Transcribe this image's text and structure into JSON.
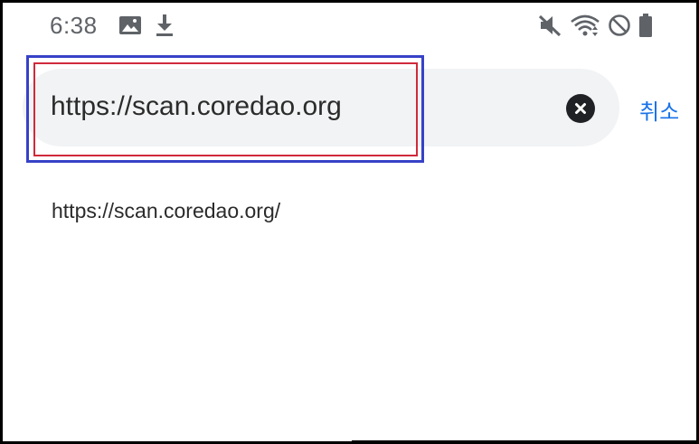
{
  "status_bar": {
    "time": "6:38",
    "left_icons": [
      "image-icon",
      "download-icon"
    ],
    "right_icons": [
      "mute-icon",
      "wifi-icon",
      "do-not-disturb-icon",
      "battery-icon"
    ]
  },
  "search": {
    "url_value": "https://scan.coredao.org",
    "clear_icon": "clear-icon",
    "cancel_label": "취소"
  },
  "suggestions": [
    {
      "label": "https://scan.coredao.org/"
    }
  ],
  "colors": {
    "accent": "#1a73e8",
    "pill_bg": "#f1f3f4",
    "highlight_outer": "#3742c7",
    "highlight_inner": "#d02a3b"
  }
}
